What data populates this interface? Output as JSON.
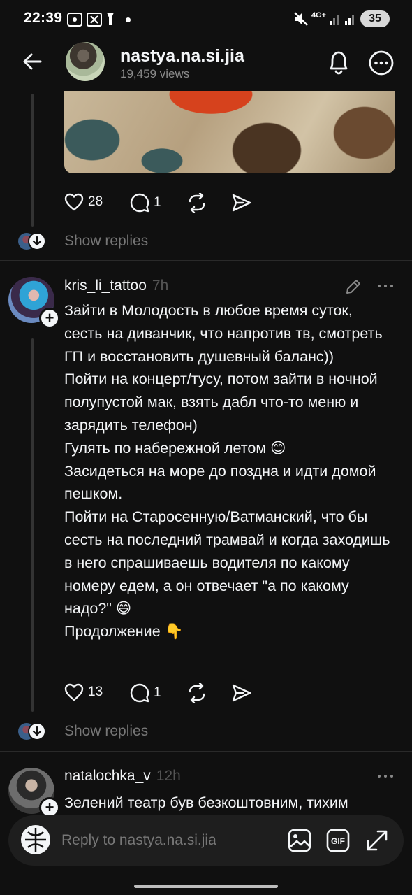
{
  "status_bar": {
    "time": "22:39",
    "network": "4G+",
    "battery": "35"
  },
  "header": {
    "title": "nastya.na.si.jia",
    "subtitle": "19,459 views"
  },
  "top_post": {
    "likes": "28",
    "replies": "1",
    "show_replies": "Show replies"
  },
  "comment1": {
    "username": "kris_li_tattoo",
    "time": "7h",
    "text": "Зайти в Молодость в любое время суток, сесть на диванчик, что напротив тв, смотреть ГП и восстановить душевный баланс))\nПойти на концерт/тусу, потом зайти в ночной полупустой мак, взять дабл что-то меню и зарядить телефон)\nГулять по набережной летом 😊\nЗасидеться на море до поздна и идти домой пешком.\nПойти на Старосенную/Ватманский, что бы сесть на последний трамвай и когда заходишь в него спрашиваешь водителя по какому номеру едем, а он отвечает \"а по какому надо?\" 😄\nПродолжение 👇",
    "likes": "13",
    "replies": "1",
    "show_replies": "Show replies"
  },
  "comment2": {
    "username": "natalochka_v",
    "time": "12h",
    "text": "Зелений театр був безкоштовним, тихим"
  },
  "reply_bar": {
    "placeholder": "Reply to nastya.na.si.jia"
  },
  "icons": [
    "back-arrow-icon",
    "bell-icon",
    "more-icon",
    "heart-icon",
    "comment-icon",
    "repost-icon",
    "send-icon",
    "edit-icon",
    "plus-icon",
    "down-arrow-icon",
    "image-icon",
    "gif-icon",
    "expand-icon"
  ]
}
